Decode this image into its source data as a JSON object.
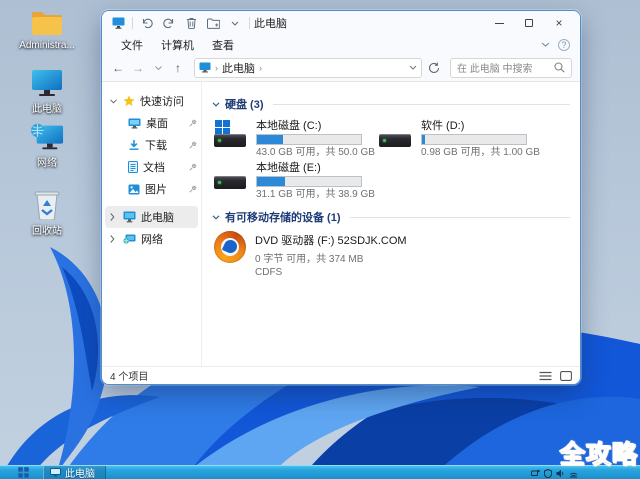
{
  "colors": {
    "accent": "#2c89d8",
    "taskbar": "#28a4de",
    "watermark": "#e42b1e",
    "window_border": "#4a8fd4",
    "section_title": "#1e3c78"
  },
  "desktop": {
    "icons": [
      {
        "label": "Administra..."
      },
      {
        "label": "此电脑"
      },
      {
        "label": "网络"
      },
      {
        "label": "回收站"
      }
    ],
    "watermark": "全攻略"
  },
  "window": {
    "title": "此电脑",
    "menu": {
      "file": "文件",
      "computer": "计算机",
      "view": "查看"
    },
    "address": {
      "crumb_root": "此电脑",
      "search_placeholder": "在 此电脑 中搜索"
    },
    "sidebar": {
      "quick_access": "快速访问",
      "items": [
        {
          "label": "桌面"
        },
        {
          "label": "下载"
        },
        {
          "label": "文档"
        },
        {
          "label": "图片"
        }
      ],
      "this_pc": "此电脑",
      "network": "网络"
    },
    "sections": {
      "drives": "硬盘 (3)",
      "removable": "有可移动存储的设备 (1)"
    },
    "drives": [
      {
        "name": "本地磁盘 (C:)",
        "info": "43.0 GB 可用，共 50.0 GB",
        "fill_percent": 25
      },
      {
        "name": "软件 (D:)",
        "info": "0.98 GB 可用，共 1.00 GB",
        "fill_percent": 3
      },
      {
        "name": "本地磁盘 (E:)",
        "info": "31.1 GB 可用，共 38.9 GB",
        "fill_percent": 27
      }
    ],
    "dvd": {
      "name": "DVD 驱动器 (F:) 52SDJK.COM",
      "info": "0 字节 可用，共 374 MB",
      "filesystem": "CDFS"
    },
    "statusbar": {
      "item_count": "4 个项目"
    }
  },
  "taskbar": {
    "task_button": "此电脑"
  }
}
